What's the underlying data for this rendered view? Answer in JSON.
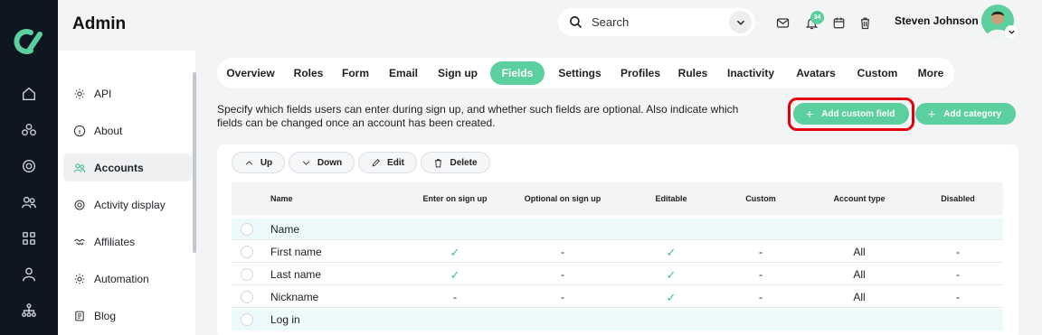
{
  "header": {
    "title": "Admin",
    "search_placeholder": "Search",
    "notification_count": "34",
    "user_name": "Steven Johnson"
  },
  "colors": {
    "accent": "#5bcf9e",
    "rail": "#0e1620",
    "highlight": "#e3000f"
  },
  "rail_icons": [
    "home-icon",
    "users-group-icon",
    "target-icon",
    "people-icon",
    "grid-icon",
    "person-icon",
    "hierarchy-icon"
  ],
  "sidebar": {
    "items": [
      {
        "label": "API",
        "icon": "gear-icon"
      },
      {
        "label": "About",
        "icon": "info-icon"
      },
      {
        "label": "Accounts",
        "icon": "people-icon",
        "active": true
      },
      {
        "label": "Activity display",
        "icon": "target-icon"
      },
      {
        "label": "Affiliates",
        "icon": "handshake-icon"
      },
      {
        "label": "Automation",
        "icon": "gear-icon"
      },
      {
        "label": "Blog",
        "icon": "document-icon"
      }
    ]
  },
  "tabs": [
    {
      "label": "Overview"
    },
    {
      "label": "Roles"
    },
    {
      "label": "Form"
    },
    {
      "label": "Email"
    },
    {
      "label": "Sign up"
    },
    {
      "label": "Fields",
      "active": true
    },
    {
      "label": "Settings"
    },
    {
      "label": "Profiles"
    },
    {
      "label": "Rules"
    },
    {
      "label": "Inactivity"
    },
    {
      "label": "Avatars"
    },
    {
      "label": "Custom"
    },
    {
      "label": "More"
    }
  ],
  "description": "Specify which fields users can enter during sign up, and whether such fields are optional. Also indicate which fields can be changed once an account has been created.",
  "actions": {
    "add_custom_field": "Add custom field",
    "add_category": "Add category"
  },
  "toolbar": {
    "up": "Up",
    "down": "Down",
    "edit": "Edit",
    "delete": "Delete"
  },
  "table": {
    "columns": [
      "Name",
      "Enter on sign up",
      "Optional on sign up",
      "Editable",
      "Custom",
      "Account type",
      "Disabled"
    ],
    "rows": [
      {
        "type": "category",
        "name": "Name"
      },
      {
        "type": "field",
        "name": "First name",
        "enter": "✓",
        "optional": "-",
        "editable": "✓",
        "custom": "-",
        "account_type": "All",
        "disabled": "-"
      },
      {
        "type": "field",
        "name": "Last name",
        "enter": "✓",
        "optional": "-",
        "editable": "✓",
        "custom": "-",
        "account_type": "All",
        "disabled": "-"
      },
      {
        "type": "field",
        "name": "Nickname",
        "enter": "-",
        "optional": "-",
        "editable": "✓",
        "custom": "-",
        "account_type": "All",
        "disabled": "-"
      },
      {
        "type": "category",
        "name": "Log in"
      }
    ]
  }
}
